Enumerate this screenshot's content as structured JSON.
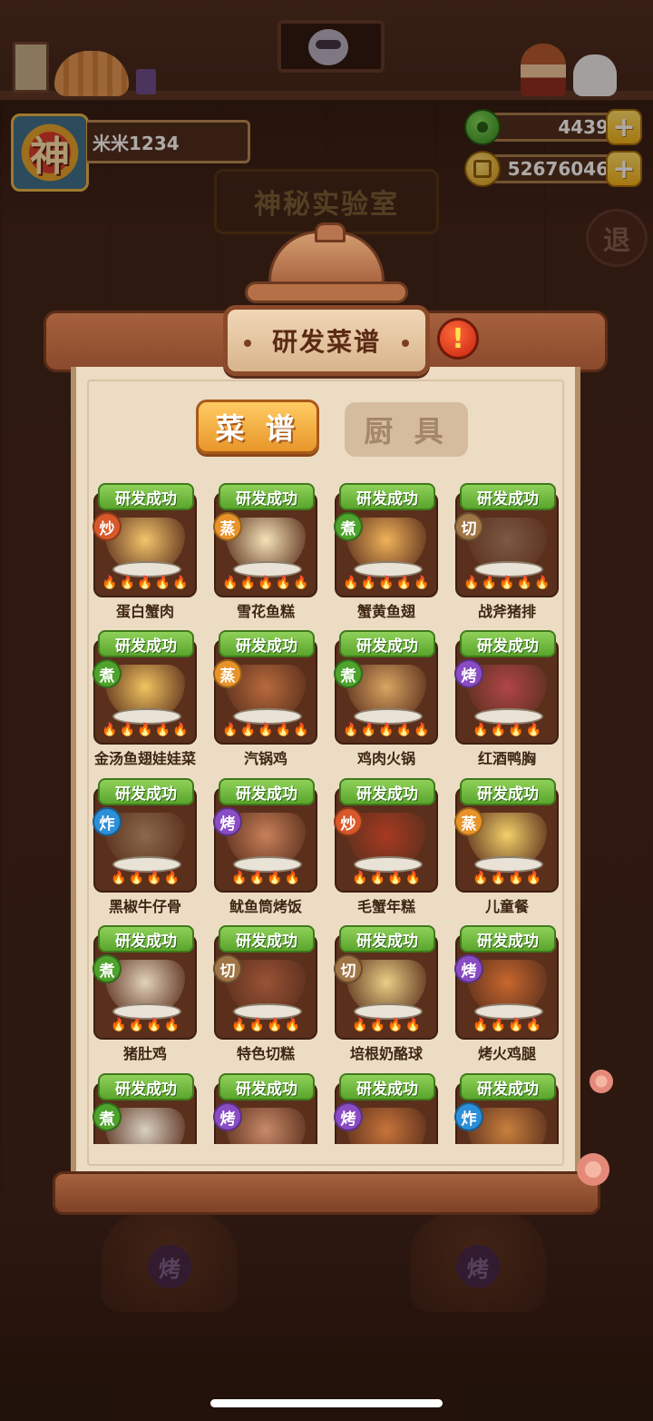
{
  "player": {
    "avatar_char": "神",
    "name": "米米1234"
  },
  "currency": {
    "jade": "4439",
    "gold": "52676046",
    "plus": "+"
  },
  "scene": {
    "lab_title": "神秘实验室",
    "exit_label": "退",
    "stove_left": "烤",
    "stove_right": "烤"
  },
  "modal": {
    "title": "研发菜谱",
    "alert": "!",
    "tabs": {
      "recipes": "菜 谱",
      "tools": "厨 具"
    }
  },
  "colors": {
    "method_stir_fry": "#d8582a",
    "method_steam": "#e8932a",
    "method_boil": "#4ea32c",
    "method_cut": "#a07545",
    "method_roast": "#8a4cc4",
    "method_fry": "#2c8fd8"
  },
  "recipes": [
    {
      "badge": "研发成功",
      "method": "炒",
      "method_color": "#d8582a",
      "name": "蛋白蟹肉",
      "dish_color": "#f2c56b",
      "flames": [
        "🔥",
        "🔥",
        "🔥",
        "🔥",
        "🔥"
      ]
    },
    {
      "badge": "研发成功",
      "method": "蒸",
      "method_color": "#e8932a",
      "name": "雪花鱼糕",
      "dish_color": "#f4e3b8",
      "flames": [
        "🔥",
        "🔥",
        "🔥",
        "🔥",
        "🔥"
      ]
    },
    {
      "badge": "研发成功",
      "method": "煮",
      "method_color": "#4ea32c",
      "name": "蟹黄鱼翅",
      "dish_color": "#f0b25a",
      "flames": [
        "🔥",
        "🔥",
        "🔥",
        "🔥",
        "🔥"
      ]
    },
    {
      "badge": "研发成功",
      "method": "切",
      "method_color": "#a07545",
      "name": "战斧猪排",
      "dish_color": "#7b5a44",
      "flames": [
        "🔥",
        "🔥",
        "🔥",
        "🔥",
        "🔥"
      ]
    },
    {
      "badge": "研发成功",
      "method": "煮",
      "method_color": "#4ea32c",
      "name": "金汤鱼翅娃娃菜",
      "dish_color": "#f0c460",
      "flames": [
        "🔥",
        "🔥",
        "🔥",
        "🔥",
        "🔥"
      ]
    },
    {
      "badge": "研发成功",
      "method": "蒸",
      "method_color": "#e8932a",
      "name": "汽锅鸡",
      "dish_color": "#b86a3c",
      "flames": [
        "🔥",
        "🔥",
        "🔥",
        "🔥",
        "🔥"
      ]
    },
    {
      "badge": "研发成功",
      "method": "煮",
      "method_color": "#4ea32c",
      "name": "鸡肉火锅",
      "dish_color": "#d9a562",
      "flames": [
        "🔥",
        "🔥",
        "🔥",
        "🔥",
        "🔥"
      ]
    },
    {
      "badge": "研发成功",
      "method": "烤",
      "method_color": "#8a4cc4",
      "name": "红酒鸭胸",
      "dish_color": "#b0454a",
      "flames": [
        "🔥",
        "🔥",
        "🔥",
        "🔥"
      ]
    },
    {
      "badge": "研发成功",
      "method": "炸",
      "method_color": "#2c8fd8",
      "name": "黑椒牛仔骨",
      "dish_color": "#8a6a4c",
      "flames": [
        "🔥",
        "🔥",
        "🔥",
        "🔥"
      ]
    },
    {
      "badge": "研发成功",
      "method": "烤",
      "method_color": "#8a4cc4",
      "name": "鱿鱼筒烤饭",
      "dish_color": "#c9805a",
      "flames": [
        "🔥",
        "🔥",
        "🔥",
        "🔥"
      ]
    },
    {
      "badge": "研发成功",
      "method": "炒",
      "method_color": "#d8582a",
      "name": "毛蟹年糕",
      "dish_color": "#a83a22",
      "flames": [
        "🔥",
        "🔥",
        "🔥",
        "🔥"
      ]
    },
    {
      "badge": "研发成功",
      "method": "蒸",
      "method_color": "#e8932a",
      "name": "儿童餐",
      "dish_color": "#f2d06a",
      "flames": [
        "🔥",
        "🔥",
        "🔥",
        "🔥"
      ]
    },
    {
      "badge": "研发成功",
      "method": "煮",
      "method_color": "#4ea32c",
      "name": "猪肚鸡",
      "dish_color": "#e2d2bb",
      "flames": [
        "🔥",
        "🔥",
        "🔥",
        "🔥"
      ]
    },
    {
      "badge": "研发成功",
      "method": "切",
      "method_color": "#a07545",
      "name": "特色切糕",
      "dish_color": "#9a5236",
      "flames": [
        "🔥",
        "🔥",
        "🔥",
        "🔥"
      ]
    },
    {
      "badge": "研发成功",
      "method": "切",
      "method_color": "#a07545",
      "name": "培根奶酪球",
      "dish_color": "#e9cf86",
      "flames": [
        "🔥",
        "🔥",
        "🔥",
        "🔥"
      ]
    },
    {
      "badge": "研发成功",
      "method": "烤",
      "method_color": "#8a4cc4",
      "name": "烤火鸡腿",
      "dish_color": "#c8672e",
      "flames": [
        "🔥",
        "🔥",
        "🔥",
        "🔥"
      ]
    },
    {
      "badge": "研发成功",
      "method": "煮",
      "method_color": "#4ea32c",
      "name": "",
      "dish_color": "#d8d0c2",
      "flames": []
    },
    {
      "badge": "研发成功",
      "method": "烤",
      "method_color": "#8a4cc4",
      "name": "",
      "dish_color": "#c98a6a",
      "flames": []
    },
    {
      "badge": "研发成功",
      "method": "烤",
      "method_color": "#8a4cc4",
      "name": "",
      "dish_color": "#c8743a",
      "flames": []
    },
    {
      "badge": "研发成功",
      "method": "炸",
      "method_color": "#2c8fd8",
      "name": "",
      "dish_color": "#c9803e",
      "flames": []
    }
  ]
}
